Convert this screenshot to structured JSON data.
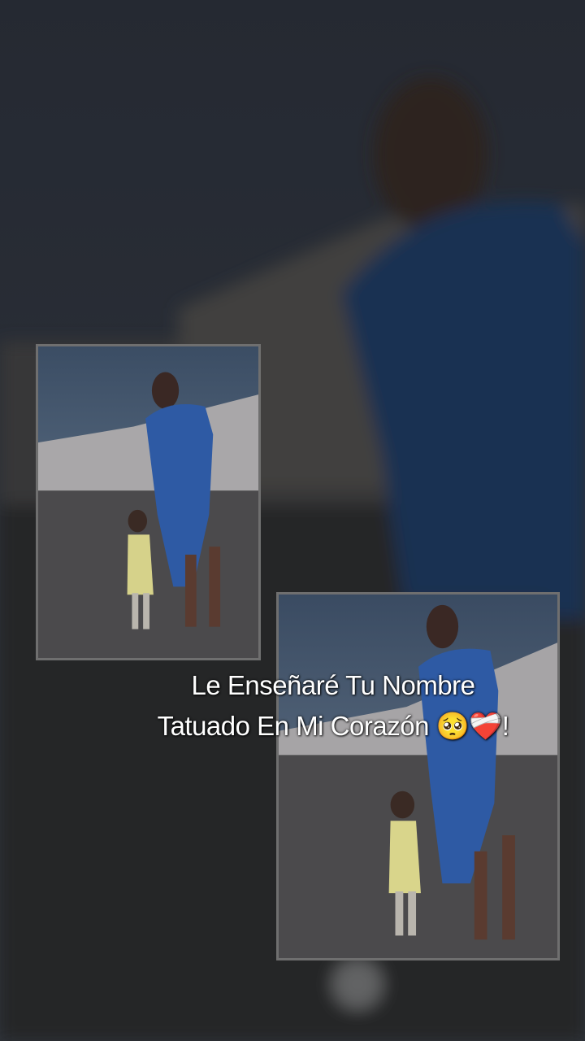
{
  "scene": {
    "background": "blurred photo of a woman in a blue dress walking with a small child outdoors, darkened",
    "accent_dress": "#2f5d9e",
    "sky": "#5a6f86",
    "ground": "#4a4a4a"
  },
  "photos": [
    {
      "name": "photo-card-left"
    },
    {
      "name": "photo-card-right"
    }
  ],
  "caption": {
    "line1": "Le Enseñaré Tu Nombre",
    "line2": "Tatuado En Mi Corazón 🥺❤️‍🩹!"
  }
}
